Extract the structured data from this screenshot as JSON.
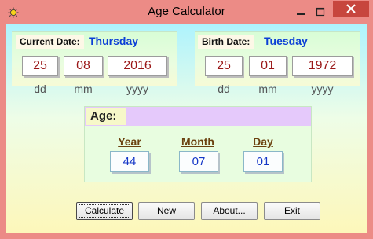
{
  "window": {
    "title": "Age Calculator",
    "colors": {
      "frame": "#ec8b86",
      "close": "#c7463e"
    }
  },
  "current": {
    "label": "Current Date:",
    "day_name": "Thursday",
    "dd": "25",
    "mm": "08",
    "yyyy": "2016",
    "hint_dd": "dd",
    "hint_mm": "mm",
    "hint_yyyy": "yyyy"
  },
  "birth": {
    "label": "Birth Date:",
    "day_name": "Tuesday",
    "dd": "25",
    "mm": "01",
    "yyyy": "1972",
    "hint_dd": "dd",
    "hint_mm": "mm",
    "hint_yyyy": "yyyy"
  },
  "age": {
    "title": "Age:",
    "year_label": "Year",
    "month_label": "Month",
    "day_label": "Day",
    "year": "44",
    "month": "07",
    "day": "01"
  },
  "buttons": {
    "calculate": "Calculate",
    "new": "New",
    "about": "About...",
    "exit": "Exit"
  }
}
